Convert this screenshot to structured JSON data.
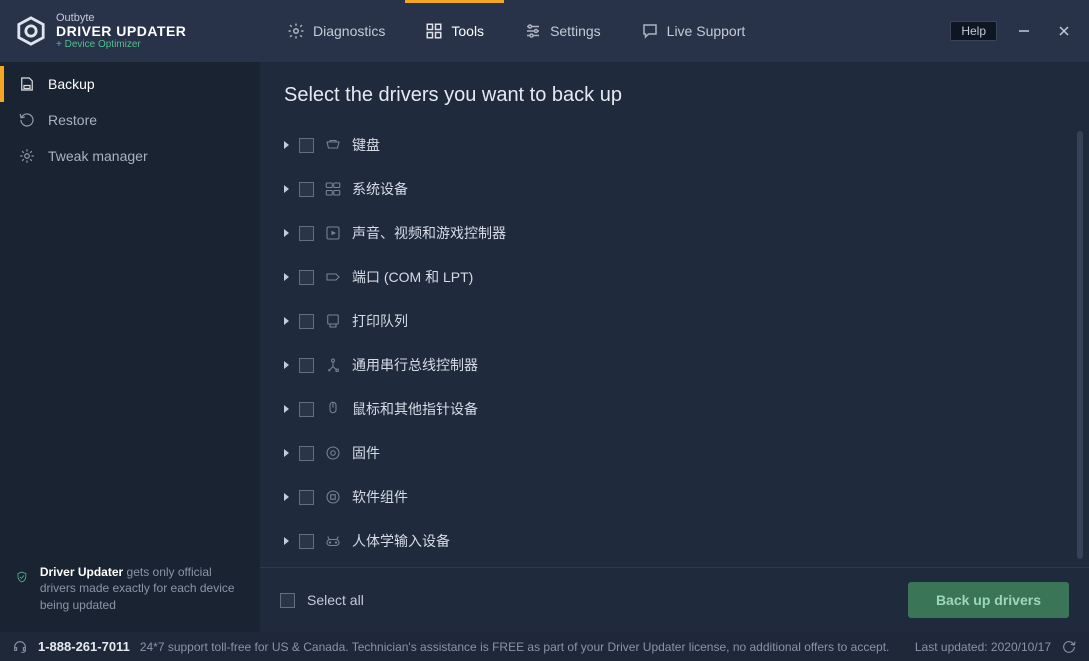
{
  "brand": {
    "company": "Outbyte",
    "product": "DRIVER UPDATER",
    "tagline": "+ Device Optimizer"
  },
  "topTabs": {
    "diagnostics": "Diagnostics",
    "tools": "Tools",
    "settings": "Settings",
    "liveSupport": "Live Support"
  },
  "help": "Help",
  "sidebar": {
    "backup": "Backup",
    "restore": "Restore",
    "tweak": "Tweak manager"
  },
  "promo": {
    "lead": "Driver Updater",
    "rest": " gets only official drivers made exactly for each device being updated"
  },
  "main": {
    "title": "Select the drivers you want to back up",
    "items": [
      "键盘",
      "系统设备",
      "声音、视频和游戏控制器",
      "端口 (COM 和 LPT)",
      "打印队列",
      "通用串行总线控制器",
      "鼠标和其他指针设备",
      "固件",
      "软件组件",
      "人体学输入设备"
    ],
    "selectAll": "Select all",
    "backupBtn": "Back up drivers"
  },
  "status": {
    "phone": "1-888-261-7011",
    "text": "24*7 support toll-free for US & Canada. Technician's assistance is FREE as part of your Driver Updater license, no additional offers to accept.",
    "lastUpdated": "Last updated: 2020/10/17"
  }
}
